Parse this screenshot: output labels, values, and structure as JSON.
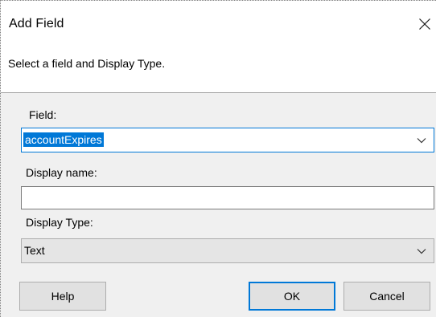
{
  "window": {
    "title": "Add Field",
    "close_icon": "close-icon"
  },
  "header": {
    "instruction": "Select a field and Display Type."
  },
  "form": {
    "field_label": "Field:",
    "field_value": "accountExpires",
    "display_name_label": "Display name:",
    "display_name_value": "",
    "display_type_label": "Display Type:",
    "display_type_value": "Text"
  },
  "buttons": {
    "help": "Help",
    "ok": "OK",
    "cancel": "Cancel"
  },
  "colors": {
    "accent": "#0078d7",
    "dialog_bg": "#f0f0f0",
    "button_bg": "#e1e1e1"
  }
}
